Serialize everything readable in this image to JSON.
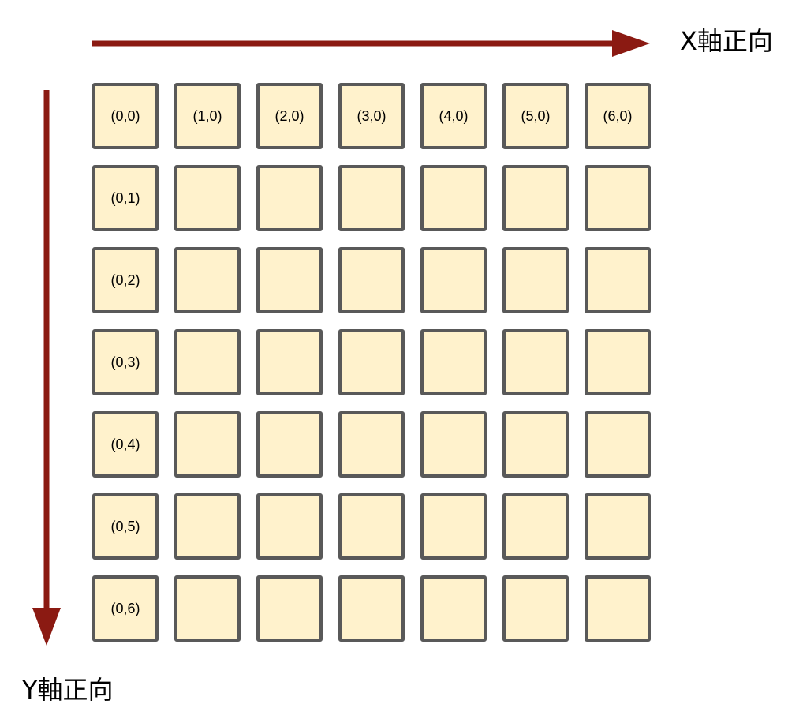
{
  "labels": {
    "x_axis": "X軸正向",
    "y_axis": "Y軸正向"
  },
  "colors": {
    "arrow": "#8B1A12",
    "cell_fill": "#FFF2CC",
    "cell_border": "#595959"
  },
  "grid": {
    "columns": 7,
    "rows": 7,
    "cells": [
      [
        "(0,0)",
        "(1,0)",
        "(2,0)",
        "(3,0)",
        "(4,0)",
        "(5,0)",
        "(6,0)"
      ],
      [
        "(0,1)",
        "",
        "",
        "",
        "",
        "",
        ""
      ],
      [
        "(0,2)",
        "",
        "",
        "",
        "",
        "",
        ""
      ],
      [
        "(0,3)",
        "",
        "",
        "",
        "",
        "",
        ""
      ],
      [
        "(0,4)",
        "",
        "",
        "",
        "",
        "",
        ""
      ],
      [
        "(0,5)",
        "",
        "",
        "",
        "",
        "",
        ""
      ],
      [
        "(0,6)",
        "",
        "",
        "",
        "",
        "",
        ""
      ]
    ]
  }
}
